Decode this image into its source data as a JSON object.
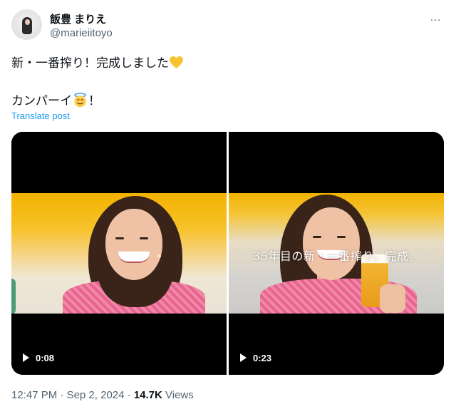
{
  "author": {
    "display_name": "飯豊 まりえ",
    "handle": "@marieiitoyo",
    "avatar_icon": "avatar-photo"
  },
  "more_icon": "…",
  "tweet": {
    "line1": "新・一番搾り！完成しました",
    "line1_emoji": "yellow-heart",
    "line2_prefix": "カンパーイ",
    "line2_emoji": "smiling-face-with-halo",
    "line2_suffix": "！"
  },
  "translate_label": "Translate post",
  "media": {
    "videos": [
      {
        "duration": "0:08",
        "play_icon": "play-icon"
      },
      {
        "duration": "0:23",
        "play_icon": "play-icon",
        "caption": "35年目の新・一番搾り、完成。"
      }
    ]
  },
  "meta": {
    "time": "12:47 PM",
    "separator": " · ",
    "date": "Sep 2, 2024",
    "views_count": "14.7K",
    "views_label": " Views"
  },
  "colors": {
    "accent": "#1d9bf0",
    "secondary_text": "#536471",
    "primary_text": "#0f1419"
  }
}
